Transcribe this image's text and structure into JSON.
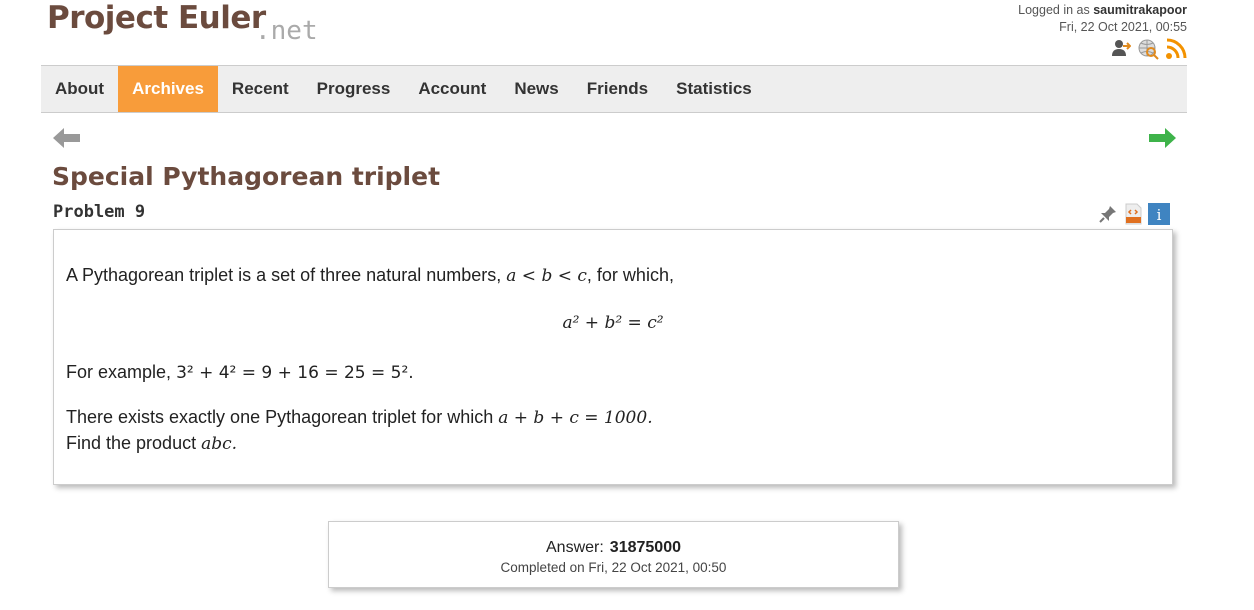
{
  "header": {
    "logo_main": "Project Euler",
    "logo_suffix": ".net",
    "logged_in_prefix": "Logged in as",
    "username": "saumitrakapoor",
    "datetime": "Fri, 22 Oct 2021, 00:55"
  },
  "nav": {
    "items": [
      "About",
      "Archives",
      "Recent",
      "Progress",
      "Account",
      "News",
      "Friends",
      "Statistics"
    ],
    "active": "Archives"
  },
  "problem": {
    "title": "Special Pythagorean triplet",
    "id": "Problem 9",
    "line1_text": "A Pythagorean triplet is a set of three natural numbers,",
    "line1_vars": "a < b < c",
    "line1_tail": ", for which,",
    "formula": "a² + b² = c²",
    "example_prefix": "For example,",
    "example_math": "3² + 4² = 9 + 16 = 25 = 5².",
    "line3_text": "There exists exactly one Pythagorean triplet for which",
    "line3_math": "a + b + c = 1000.",
    "line4_text": "Find the product",
    "line4_math": "abc."
  },
  "answer": {
    "label": "Answer:",
    "value": "31875000",
    "completed": "Completed on Fri, 22 Oct 2021, 00:50"
  }
}
